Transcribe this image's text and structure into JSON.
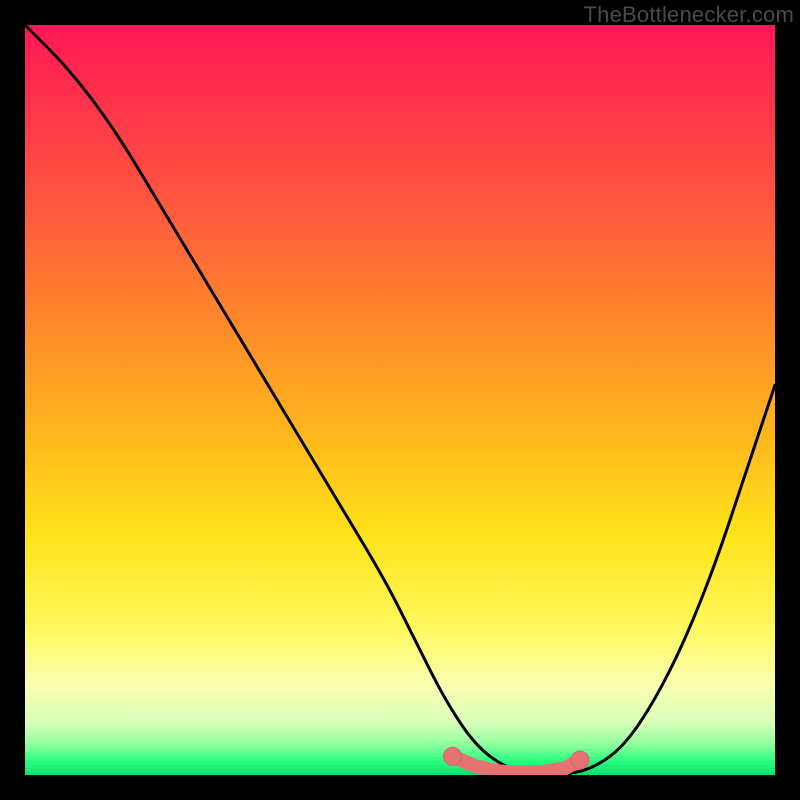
{
  "watermark": {
    "text": "TheBottlenecker.com"
  },
  "colors": {
    "curve_stroke": "#000000",
    "marker_fill": "#e57373",
    "marker_stroke": "#d66464"
  },
  "chart_data": {
    "type": "line",
    "title": "",
    "xlabel": "",
    "ylabel": "",
    "xlim": [
      0,
      100
    ],
    "ylim": [
      0,
      100
    ],
    "series": [
      {
        "name": "bottleneck-curve",
        "x": [
          0,
          6,
          12,
          18,
          24,
          30,
          36,
          42,
          48,
          52,
          56,
          60,
          64,
          68,
          72,
          76,
          80,
          84,
          88,
          92,
          96,
          100
        ],
        "y": [
          100,
          94,
          86,
          76,
          66,
          56,
          46,
          36,
          26,
          18,
          10,
          4,
          1,
          0,
          0,
          1,
          4,
          10,
          18,
          28,
          40,
          52
        ]
      }
    ],
    "markers": {
      "name": "highlighted-range",
      "x": [
        57,
        60,
        63,
        66,
        69,
        72,
        74
      ],
      "y": [
        2.5,
        1.2,
        0.5,
        0.3,
        0.4,
        0.9,
        2.0
      ]
    }
  }
}
